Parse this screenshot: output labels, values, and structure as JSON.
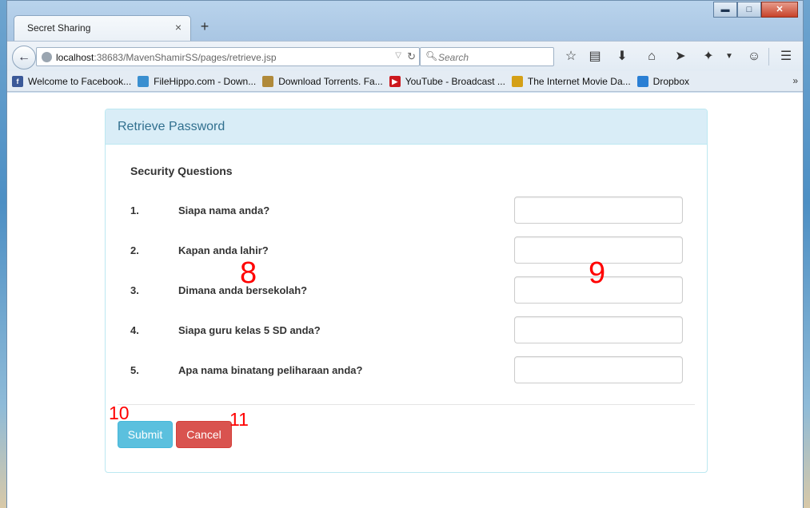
{
  "browser": {
    "tab_title": "Secret Sharing",
    "tab_close": "×",
    "new_tab": "+",
    "window_controls": {
      "minimize": "▬",
      "maximize": "□",
      "close": "✕"
    },
    "url_host": "localhost",
    "url_rest": ":38683/MavenShamirSS/pages/retrieve.jsp",
    "search_placeholder": "Search"
  },
  "bookmarks": [
    {
      "label": "Welcome to Facebook...",
      "icon": "facebook-icon",
      "color": "#3b5998",
      "glyph": "f"
    },
    {
      "label": "FileHippo.com - Down...",
      "icon": "filehippo-icon",
      "color": "#3a8fd0",
      "glyph": ""
    },
    {
      "label": "Download Torrents. Fa...",
      "icon": "shield-icon",
      "color": "#b08a3a",
      "glyph": ""
    },
    {
      "label": "YouTube - Broadcast ...",
      "icon": "youtube-icon",
      "color": "#cc181e",
      "glyph": "▶"
    },
    {
      "label": "The Internet Movie Da...",
      "icon": "imdb-icon",
      "color": "#d4a017",
      "glyph": ""
    },
    {
      "label": "Dropbox",
      "icon": "dropbox-icon",
      "color": "#2a7fd4",
      "glyph": ""
    }
  ],
  "bookmarks_more": "»",
  "panel": {
    "heading": "Retrieve Password",
    "section_title": "Security Questions",
    "questions": [
      {
        "num": "1.",
        "text": "Siapa nama anda?",
        "value": ""
      },
      {
        "num": "2.",
        "text": "Kapan anda lahir?",
        "value": ""
      },
      {
        "num": "3.",
        "text": "Dimana anda bersekolah?",
        "value": ""
      },
      {
        "num": "4.",
        "text": "Siapa guru kelas 5 SD anda?",
        "value": ""
      },
      {
        "num": "5.",
        "text": "Apa nama binatang peliharaan anda?",
        "value": ""
      }
    ],
    "submit_label": "Submit",
    "cancel_label": "Cancel"
  },
  "annotations": {
    "a8": "8",
    "a9": "9",
    "a10": "10",
    "a11": "11"
  },
  "colors": {
    "panel_heading_bg": "#d9edf7",
    "panel_heading_text": "#31708f",
    "submit_bg": "#5bc0de",
    "cancel_bg": "#d9534f",
    "annotation": "#ff0000"
  }
}
